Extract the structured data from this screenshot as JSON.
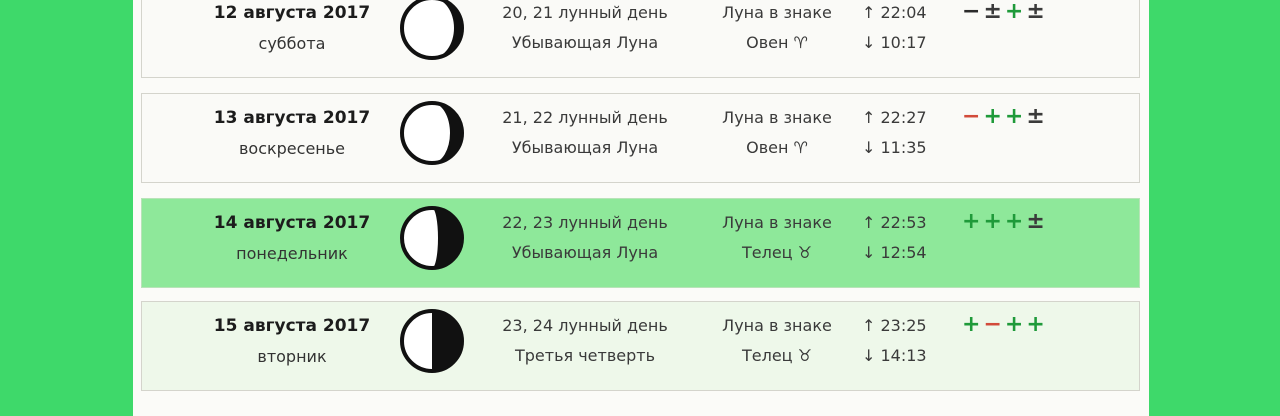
{
  "rows": [
    {
      "date": "12 августа 2017",
      "weekday": "суббота",
      "lunar_day": "20, 21 лунный день",
      "phase": "Убывающая Луна",
      "sign_label": "Луна в знаке",
      "sign": "Овен ♈",
      "rise": "↑ 22:04",
      "set": "↓ 10:17",
      "marks": [
        "−",
        "±",
        "+",
        "±"
      ]
    },
    {
      "date": "13 августа 2017",
      "weekday": "воскресенье",
      "lunar_day": "21, 22 лунный день",
      "phase": "Убывающая Луна",
      "sign_label": "Луна в знаке",
      "sign": "Овен ♈",
      "rise": "↑ 22:27",
      "set": "↓ 11:35",
      "marks": [
        "−",
        "+",
        "+",
        "±"
      ]
    },
    {
      "date": "14 августа 2017",
      "weekday": "понедельник",
      "lunar_day": "22, 23 лунный день",
      "phase": "Убывающая Луна",
      "sign_label": "Луна в знаке",
      "sign": "Телец ♉",
      "rise": "↑ 22:53",
      "set": "↓ 12:54",
      "marks": [
        "+",
        "+",
        "+",
        "±"
      ]
    },
    {
      "date": "15 августа 2017",
      "weekday": "вторник",
      "lunar_day": "23, 24 лунный день",
      "phase": "Третья четверть",
      "sign_label": "Луна в знаке",
      "sign": "Телец ♉",
      "rise": "↑ 23:25",
      "set": "↓ 14:13",
      "marks": [
        "+",
        "−",
        "+",
        "+"
      ]
    }
  ],
  "colors": {
    "background": "#3ed96a",
    "today_row": "#8ee89a",
    "plus": "#1f9a3a",
    "minus_red": "#d24b3a"
  }
}
